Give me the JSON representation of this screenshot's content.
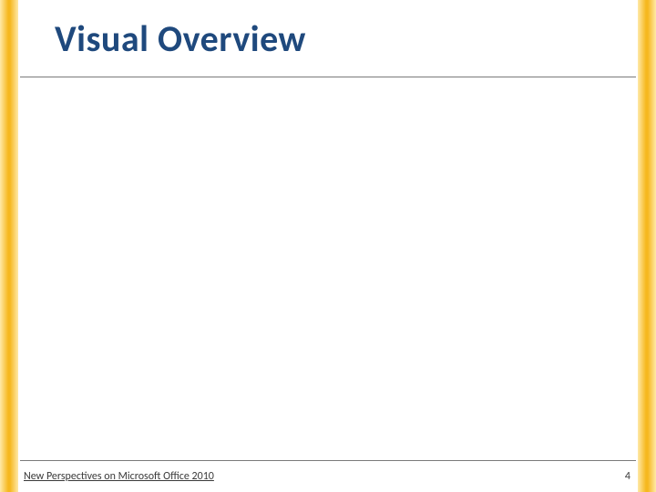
{
  "slide": {
    "title": "Visual Overview",
    "footer": "New Perspectives on Microsoft Office 2010",
    "page_number": "4"
  }
}
